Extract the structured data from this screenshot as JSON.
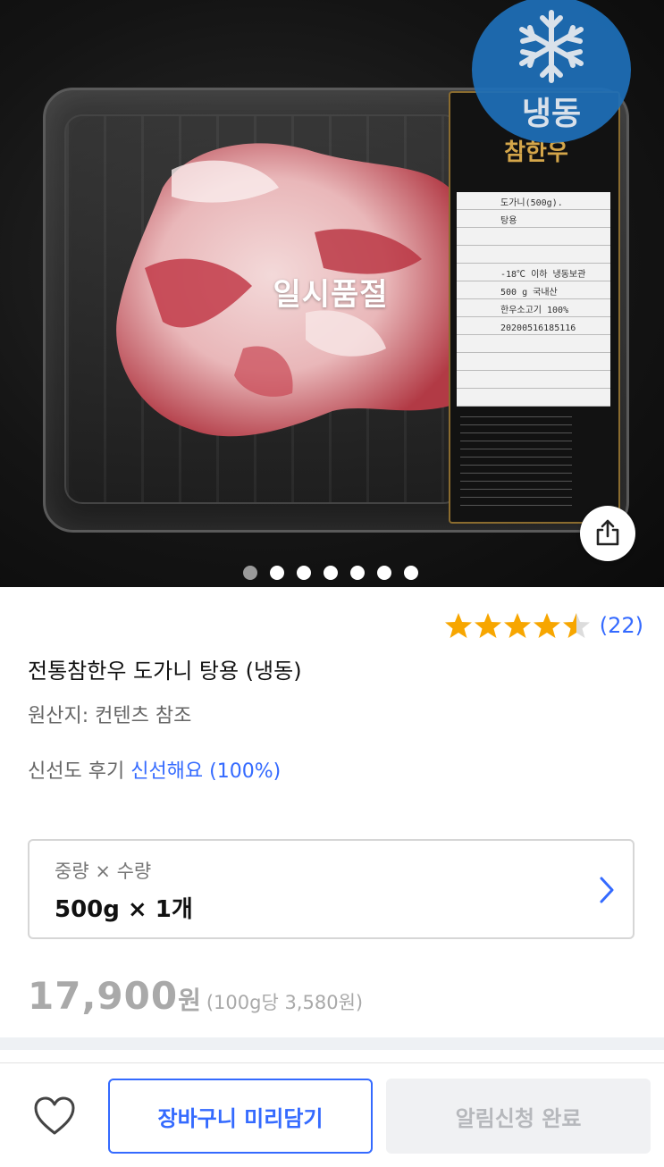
{
  "hero": {
    "badge_text": "냉동",
    "overlay_text": "일시품절",
    "label": {
      "brand": "참한우",
      "rows": [
        "도가니(500g).",
        "탕용",
        "",
        "",
        "-18℃ 이하 냉동보관",
        "500 g  국내산",
        "한우소고기 100%",
        "20200516185116",
        "",
        ""
      ]
    },
    "carousel": {
      "total": 7,
      "active_index": 0
    }
  },
  "product": {
    "rating": {
      "value": 4.5,
      "max": 5,
      "count_text": "(22)"
    },
    "title": "전통참한우 도가니 탕용 (냉동)",
    "origin": "원산지: 컨텐츠 참조",
    "freshness_label": "신선도 후기",
    "freshness_value": "신선해요 (100%)"
  },
  "option": {
    "label": "중량 × 수량",
    "value": "500g × 1개"
  },
  "price": {
    "amount": "17,900",
    "currency": "원",
    "unit_price": "(100g당 3,580원)"
  },
  "bottom": {
    "cart_label": "장바구니 미리담기",
    "notify_label": "알림신청 완료"
  },
  "colors": {
    "accent": "#346aff",
    "star": "#f7a600",
    "badge": "#1e6fb8",
    "disabled": "#a9a9a9"
  },
  "icons": {
    "badge": "snowflake-icon",
    "share": "share-icon",
    "chevron": "chevron-right-icon",
    "wish": "heart-icon",
    "rating": "star-icon"
  }
}
